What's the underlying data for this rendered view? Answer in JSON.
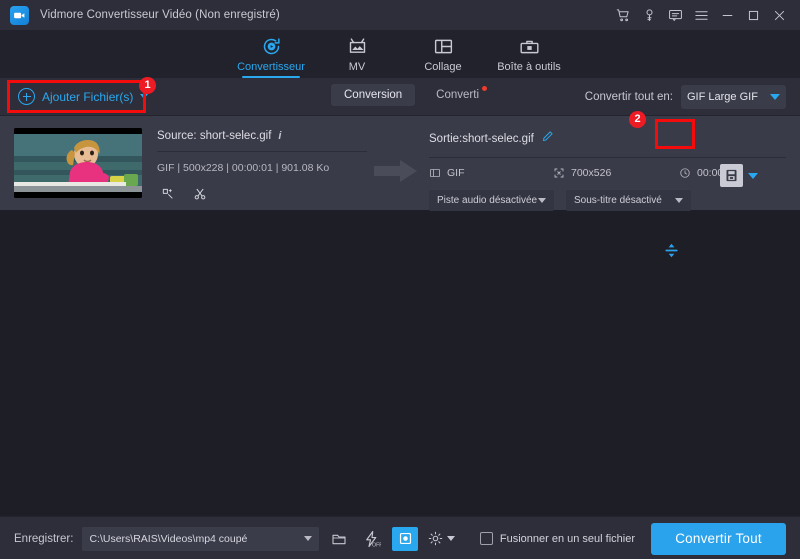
{
  "window": {
    "title": "Vidmore Convertisseur Vidéo (Non enregistré)",
    "logo_icon": "app-camera-icon",
    "controls": [
      {
        "name": "cart-icon",
        "label": "Panier"
      },
      {
        "name": "key-icon",
        "label": "Clé d'enregistrement"
      },
      {
        "name": "feedback-icon",
        "label": "Commentaires"
      },
      {
        "name": "menu-icon",
        "label": "Menu"
      },
      {
        "name": "minimize-icon",
        "label": "Réduire"
      },
      {
        "name": "maximize-icon",
        "label": "Agrandir"
      },
      {
        "name": "close-icon",
        "label": "Fermer"
      }
    ]
  },
  "nav": {
    "items": [
      {
        "label": "Convertisseur",
        "icon": "converter-icon",
        "active": true
      },
      {
        "label": "MV",
        "icon": "mv-icon",
        "active": false
      },
      {
        "label": "Collage",
        "icon": "collage-icon",
        "active": false
      },
      {
        "label": "Boîte à outils",
        "icon": "toolbox-icon",
        "active": false
      }
    ]
  },
  "toolbar": {
    "add_files_label": "Ajouter Fichier(s)",
    "tabs": [
      {
        "label": "Conversion",
        "active": true,
        "badge": false
      },
      {
        "label": "Converti",
        "active": false,
        "badge": true
      }
    ],
    "convert_all_label": "Convertir tout en:",
    "convert_all_value": "GIF Large GIF"
  },
  "file": {
    "source_label": "Source: short-selec.gif",
    "source_meta": "GIF | 500x228 | 00:00:01 | 901.08 Ko",
    "output_label": "Sortie:short-selec.gif",
    "output_format": "GIF",
    "output_resolution": "700x526",
    "output_duration": "00:00:01",
    "audio_track": "Piste audio désactivée",
    "subtitle": "Sous-titre désactivé",
    "edit_icon_name": "magic-wand-edit-icon",
    "cut_icon_name": "scissors-cut-icon",
    "rename_icon_name": "pencil-edit-icon",
    "resize_icon_name": "resize-vertical-arrows-icon",
    "preset_icon_name": "output-preset-icon"
  },
  "bottom": {
    "save_label": "Enregistrer:",
    "save_path": "C:\\Users\\RAIS\\Videos\\mp4 coupé",
    "folder_icon": "open-folder-icon",
    "hw_icon": "hardware-accel-off-icon",
    "gpu_icon": "gpu-acceleration-icon",
    "settings_icon": "gear-settings-icon",
    "merge_label": "Fusionner en un seul fichier",
    "merge_checked": false,
    "convert_button": "Convertir Tout"
  },
  "annotations": [
    {
      "name": "annotation-badge-1",
      "label": "1"
    },
    {
      "name": "annotation-badge-2",
      "label": "2"
    }
  ],
  "colors": {
    "accent": "#29a8ef",
    "highlight": "#f40b0b",
    "badge": "#ed1c24",
    "titlebar": "#2d2e3a",
    "page": "#22222c",
    "card": "#3a3b48",
    "empty": "#1e1e27"
  }
}
